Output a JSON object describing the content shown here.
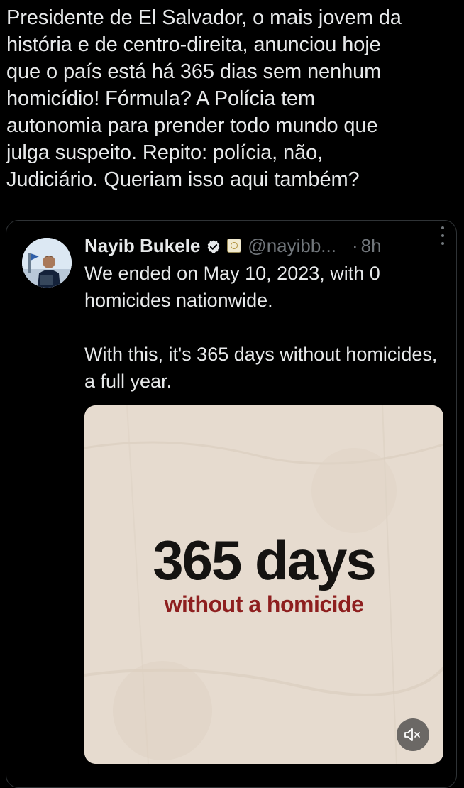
{
  "post": {
    "text": "Presidente de El Salvador, o mais jovem da\nhistória e de centro-direita, anunciou hoje\nque o país está há 365 dias sem nenhum\nhomicídio! Fórmula? A Polícia tem\nautonomia para prender todo mundo que\njulga suspeito. Repito: polícia, não,\nJudiciário. Queriam isso aqui também?"
  },
  "quoted_tweet": {
    "author_name": "Nayib Bukele",
    "verified_icon": "verified-badge-icon",
    "affiliation_icon": "government-seal-icon",
    "handle": "@nayibb...",
    "separator": "·",
    "time": "8h",
    "paragraphs": [
      "We ended on May 10, 2023, with 0 homicides nationwide.",
      "With this, it's 365 days without homicides, a full year."
    ],
    "media": {
      "headline": "365 days",
      "subheadline": "without a homicide",
      "mute_icon": "volume-muted-icon"
    }
  },
  "colors": {
    "background": "#000000",
    "text_primary": "#e7e9ea",
    "text_secondary": "#71767b",
    "border": "#2f3336",
    "media_background": "#e6dbcf",
    "media_subheadline": "#8e1f1f"
  }
}
